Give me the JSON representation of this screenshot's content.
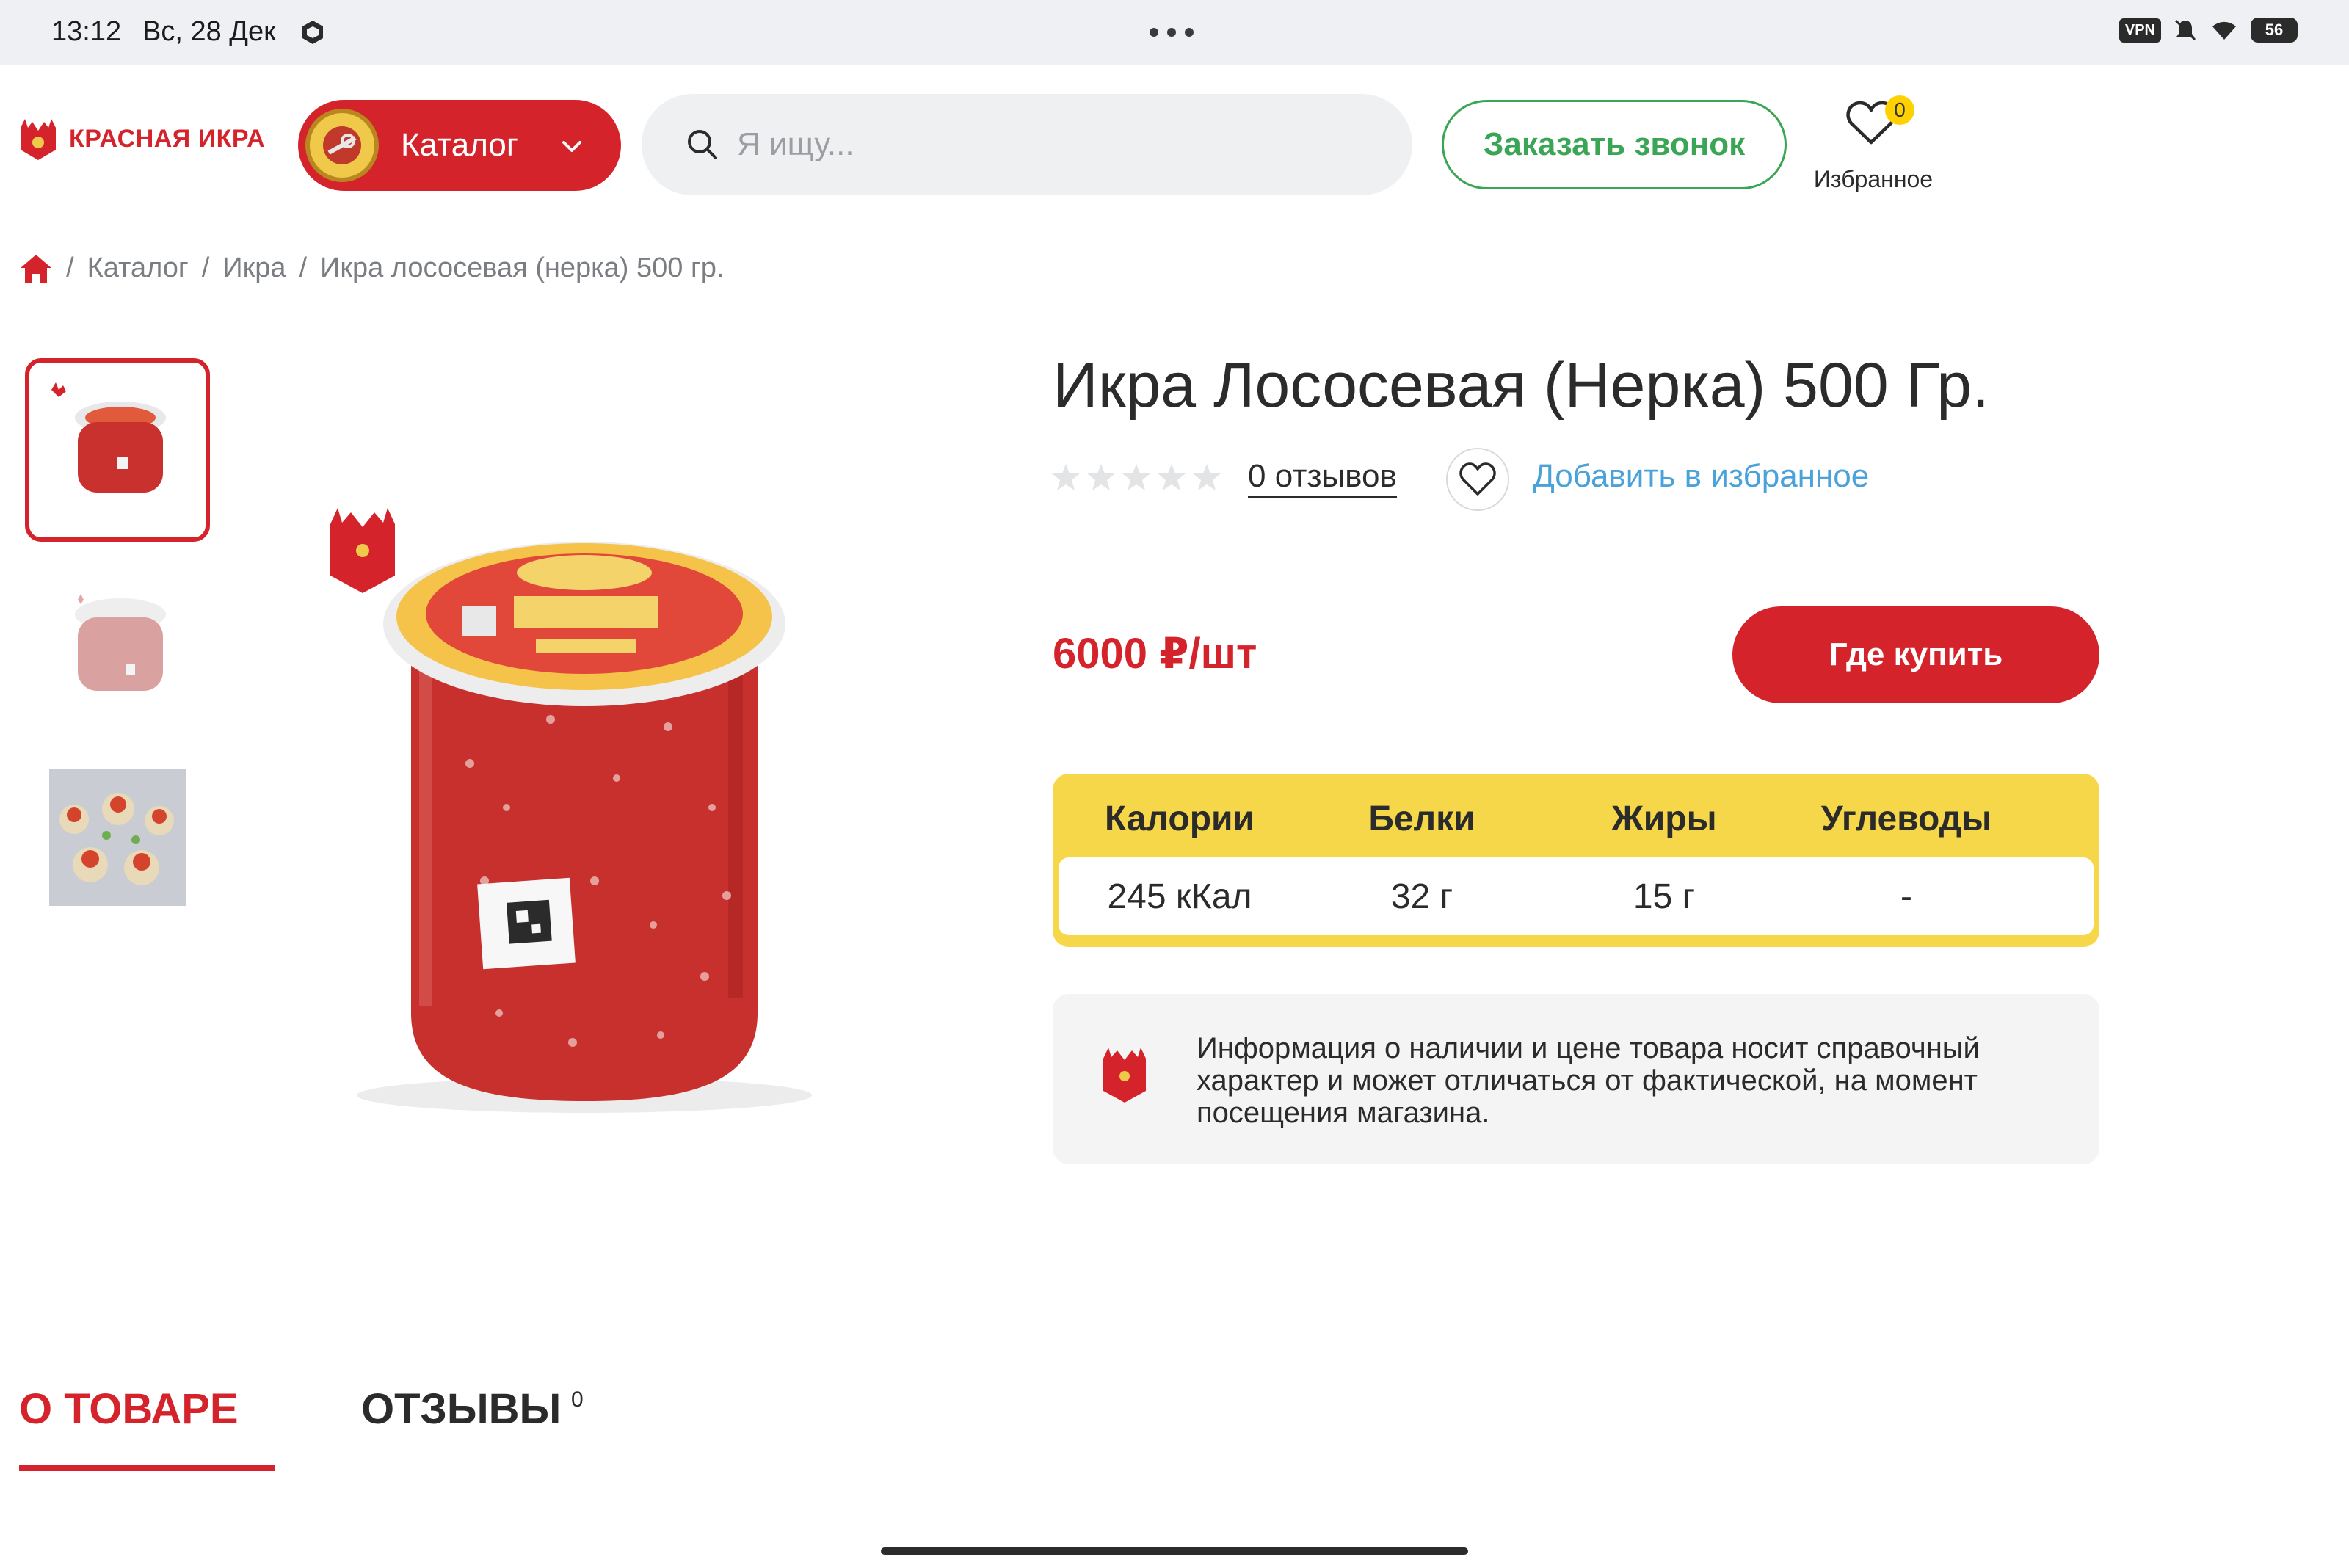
{
  "status_bar": {
    "time": "13:12",
    "date": "Вс, 28 Дек",
    "vpn": "VPN",
    "battery": "56"
  },
  "header": {
    "logo_text": "КРАСНАЯ ИКРА",
    "catalog_label": "Каталог",
    "search_placeholder": "Я ищу...",
    "call_button": "Заказать звонок",
    "favorites_label": "Избранное",
    "favorites_count": "0"
  },
  "breadcrumb": [
    "Каталог",
    "Икра",
    "Икра лососевая (нерка) 500 гр."
  ],
  "product": {
    "title": "Икра Лососевая (Нерка) 500 Гр.",
    "rating": 0,
    "rating_max": 5,
    "reviews_link": "0 отзывов",
    "add_favorite": "Добавить в избранное",
    "price": "6000 ₽/шт",
    "buy_button": "Где купить"
  },
  "nutrition": {
    "headers": [
      "Калории",
      "Белки",
      "Жиры",
      "Углеводы"
    ],
    "values": [
      "245 кКал",
      "32 г",
      "15 г",
      "-"
    ]
  },
  "notice": "Информация о наличии и цене товара носит справочный характер и может отличаться от фактической, на момент посещения магазина.",
  "tabs": {
    "about": "О ТОВАРЕ",
    "reviews": "ОТЗЫВЫ",
    "reviews_count": "0"
  },
  "colors": {
    "brand_red": "#d4232b",
    "call_green": "#3aa655",
    "link_blue": "#4aa2d9",
    "nutrition_yellow": "#f7d74a"
  }
}
